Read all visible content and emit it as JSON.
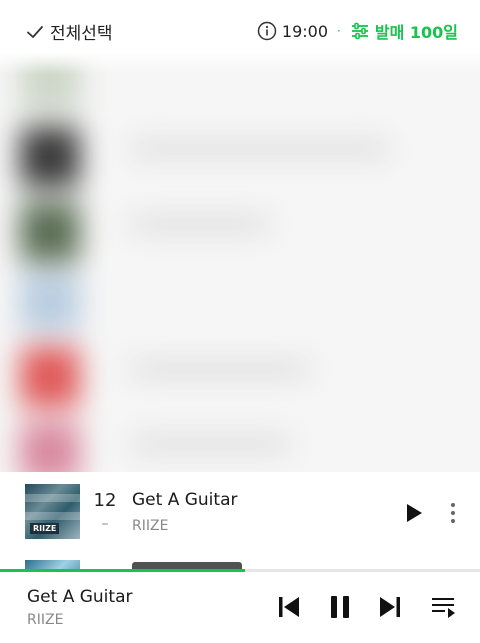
{
  "toolbar": {
    "select_all_label": "전체선택",
    "time": "19:00",
    "separator": "·",
    "filter_label": "발매 100일",
    "accent_color": "#19c34d"
  },
  "song": {
    "rank": "12",
    "rank_change": "–",
    "title": "Get A Guitar",
    "artist": "RIIZE",
    "album_logo": "RIIZE"
  },
  "player": {
    "title": "Get A Guitar",
    "artist": "RIIZE",
    "progress": 0.51
  },
  "icons": {
    "select_all": "check-icon",
    "info": "info-icon",
    "filter": "filter-sliders-icon",
    "play": "play-icon",
    "more": "more-vertical-icon",
    "prev": "skip-previous-icon",
    "pause": "pause-icon",
    "next": "skip-next-icon",
    "queue": "playlist-icon"
  }
}
